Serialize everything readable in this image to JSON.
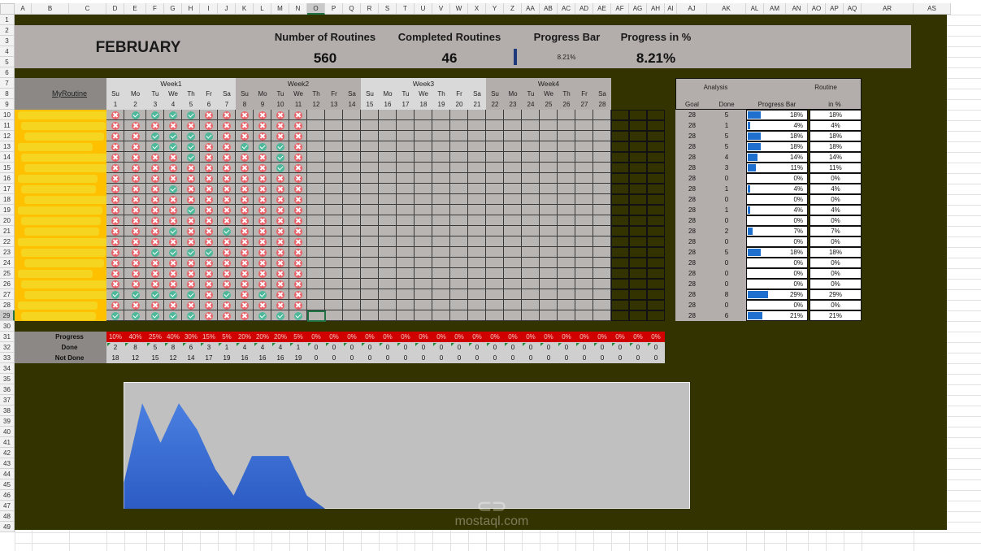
{
  "sheet": {
    "columns": [
      "A",
      "B",
      "C",
      "D",
      "E",
      "F",
      "G",
      "H",
      "I",
      "J",
      "K",
      "L",
      "M",
      "N",
      "O",
      "P",
      "Q",
      "R",
      "S",
      "T",
      "U",
      "V",
      "W",
      "X",
      "Y",
      "Z",
      "AA",
      "AB",
      "AC",
      "AD",
      "AE",
      "AF",
      "AG",
      "AH",
      "AI",
      "AJ",
      "AK",
      "AL",
      "AM",
      "AN",
      "AO",
      "AP",
      "AQ",
      "AR",
      "AS"
    ],
    "selected_column": "O",
    "rows": [
      "1",
      "2",
      "3",
      "4",
      "5",
      "6",
      "7",
      "8",
      "9",
      "10",
      "11",
      "12",
      "13",
      "14",
      "15",
      "16",
      "17",
      "18",
      "19",
      "20",
      "21",
      "22",
      "23",
      "24",
      "25",
      "26",
      "27",
      "28",
      "29",
      "30",
      "31",
      "32",
      "33",
      "34",
      "35",
      "36",
      "37",
      "38",
      "39",
      "40",
      "41",
      "42",
      "43",
      "44",
      "45",
      "46",
      "47",
      "48",
      "49"
    ],
    "selected_row": "29"
  },
  "header": {
    "month": "FEBRUARY",
    "number_of_routines_label": "Number of Routines",
    "number_of_routines_value": "560",
    "completed_routines_label": "Completed Routines",
    "completed_routines_value": "46",
    "progress_bar_label": "Progress Bar",
    "progress_bar_value": "8.21%",
    "progress_bar_fraction": 0.0821,
    "progress_pct_label": "Progress in %",
    "progress_pct_value": "8.21%"
  },
  "tracker": {
    "routine_header": "MyRoutine",
    "weeks": [
      "Week1",
      "Week2",
      "Week3",
      "Week4"
    ],
    "day_names": [
      "Su",
      "Mo",
      "Tu",
      "We",
      "Th",
      "Fr",
      "Sa",
      "Su",
      "Mo",
      "Tu",
      "We",
      "Th",
      "Fr",
      "Sa",
      "Su",
      "Mo",
      "Tu",
      "We",
      "Th",
      "Fr",
      "Sa",
      "Su",
      "Mo",
      "Tu",
      "We",
      "Th",
      "Fr",
      "Sa"
    ],
    "day_numbers": [
      "1",
      "2",
      "3",
      "4",
      "5",
      "6",
      "7",
      "8",
      "9",
      "10",
      "11",
      "12",
      "13",
      "14",
      "15",
      "16",
      "17",
      "18",
      "19",
      "20",
      "21",
      "22",
      "23",
      "24",
      "25",
      "26",
      "27",
      "28"
    ],
    "status_rows": [
      "xccccxxxxxx",
      "xxxxxxxxxxx",
      "xxccccxxxxx",
      "xxcccxxcccx",
      "xxxxcxxxxcx",
      "xxxxxxxxxcx",
      "xxxxxxxxxxx",
      "xxxcxxxxxxx",
      "xxxxxxxxxxx",
      "xxxxcxxxxxx",
      "xxxxxxxxxxx",
      "xxxcxxcxxxx",
      "xxxxxxxxxxx",
      "xxccccxxxxx",
      "xxxxxxxxxxx",
      "xxxxxxxxxxx",
      "xxxxxxxxxxx",
      "cccccxcxcxx",
      "xxxxxxxxxxx",
      "cccccxxxccc"
    ]
  },
  "analysis": {
    "title": "Analysis",
    "routine_label": "Routine",
    "goal_label": "Goal",
    "done_label": "Done",
    "progress_bar_label": "Progress Bar",
    "in_pct_label": "in %",
    "rows": [
      {
        "goal": "28",
        "done": "5",
        "pct": "18%",
        "fraction": 0.18
      },
      {
        "goal": "28",
        "done": "1",
        "pct": "4%",
        "fraction": 0.04
      },
      {
        "goal": "28",
        "done": "5",
        "pct": "18%",
        "fraction": 0.18
      },
      {
        "goal": "28",
        "done": "5",
        "pct": "18%",
        "fraction": 0.18
      },
      {
        "goal": "28",
        "done": "4",
        "pct": "14%",
        "fraction": 0.14
      },
      {
        "goal": "28",
        "done": "3",
        "pct": "11%",
        "fraction": 0.11
      },
      {
        "goal": "28",
        "done": "0",
        "pct": "0%",
        "fraction": 0
      },
      {
        "goal": "28",
        "done": "1",
        "pct": "4%",
        "fraction": 0.04
      },
      {
        "goal": "28",
        "done": "0",
        "pct": "0%",
        "fraction": 0
      },
      {
        "goal": "28",
        "done": "1",
        "pct": "4%",
        "fraction": 0.04
      },
      {
        "goal": "28",
        "done": "0",
        "pct": "0%",
        "fraction": 0
      },
      {
        "goal": "28",
        "done": "2",
        "pct": "7%",
        "fraction": 0.07
      },
      {
        "goal": "28",
        "done": "0",
        "pct": "0%",
        "fraction": 0
      },
      {
        "goal": "28",
        "done": "5",
        "pct": "18%",
        "fraction": 0.18
      },
      {
        "goal": "28",
        "done": "0",
        "pct": "0%",
        "fraction": 0
      },
      {
        "goal": "28",
        "done": "0",
        "pct": "0%",
        "fraction": 0
      },
      {
        "goal": "28",
        "done": "0",
        "pct": "0%",
        "fraction": 0
      },
      {
        "goal": "28",
        "done": "8",
        "pct": "29%",
        "fraction": 0.29
      },
      {
        "goal": "28",
        "done": "0",
        "pct": "0%",
        "fraction": 0
      },
      {
        "goal": "28",
        "done": "6",
        "pct": "21%",
        "fraction": 0.21
      }
    ]
  },
  "summary": {
    "progress_label": "Progress",
    "done_label": "Done",
    "not_done_label": "Not Done",
    "progress": [
      "10%",
      "40%",
      "25%",
      "40%",
      "30%",
      "15%",
      "5%",
      "20%",
      "20%",
      "20%",
      "5%",
      "0%",
      "0%",
      "0%",
      "0%",
      "0%",
      "0%",
      "0%",
      "0%",
      "0%",
      "0%",
      "0%",
      "0%",
      "0%",
      "0%",
      "0%",
      "0%",
      "0%",
      "0%",
      "0%",
      "0%",
      "0%"
    ],
    "done": [
      "2",
      "8",
      "5",
      "8",
      "6",
      "3",
      "1",
      "4",
      "4",
      "4",
      "1",
      "0",
      "0",
      "0",
      "0",
      "0",
      "0",
      "0",
      "0",
      "0",
      "0",
      "0",
      "0",
      "0",
      "0",
      "0",
      "0",
      "0",
      "0",
      "0",
      "0",
      "0"
    ],
    "not_done": [
      "18",
      "12",
      "15",
      "12",
      "14",
      "17",
      "19",
      "16",
      "16",
      "16",
      "19",
      "0",
      "0",
      "0",
      "0",
      "0",
      "0",
      "0",
      "0",
      "0",
      "0",
      "0",
      "0",
      "0",
      "0",
      "0",
      "0",
      "0",
      "0",
      "0",
      "0",
      "0"
    ]
  },
  "chart_data": {
    "type": "area",
    "x": [
      "1",
      "2",
      "3",
      "4",
      "5",
      "6",
      "7",
      "8",
      "9",
      "10",
      "11",
      "12",
      "13",
      "14",
      "15",
      "16",
      "17",
      "18",
      "19",
      "20",
      "21",
      "22",
      "23",
      "24",
      "25",
      "26",
      "27",
      "28",
      "29",
      "30",
      "31",
      "32"
    ],
    "values": [
      10,
      40,
      25,
      40,
      30,
      15,
      5,
      20,
      20,
      20,
      5,
      0,
      0,
      0,
      0,
      0,
      0,
      0,
      0,
      0,
      0,
      0,
      0,
      0,
      0,
      0,
      0,
      0,
      0,
      0,
      0,
      0
    ],
    "ylim": [
      0,
      45
    ],
    "color": "#3f6fd1",
    "background": "#c0c0c0",
    "grid": false
  },
  "colors": {
    "dark_bg": "#333300",
    "header_band": "#b3adab",
    "routine_fill": "#ffc000",
    "x_icon": "#e8646a",
    "check_icon": "#4fb89a",
    "progress_row": "#d10000",
    "bar_blue": "#1f6fcf",
    "header_bar": "#1f3a7a"
  },
  "watermark": "mostaql.com"
}
